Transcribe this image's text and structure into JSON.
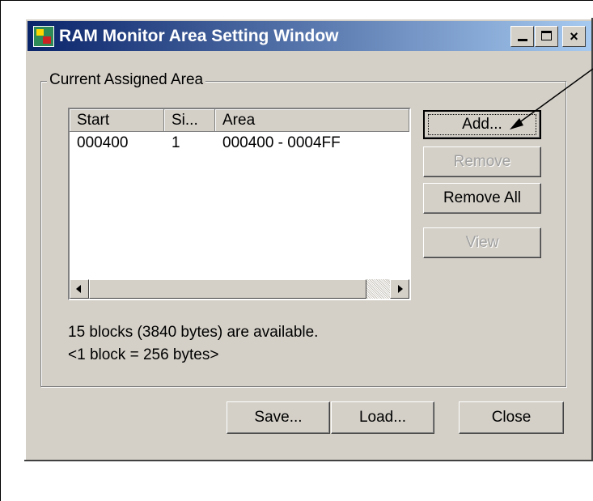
{
  "window": {
    "title": "RAM Monitor Area Setting Window",
    "titlebar_buttons": {
      "minimize": "minimize",
      "maximize": "maximize",
      "close": "×"
    }
  },
  "group": {
    "label": "Current Assigned Area"
  },
  "list": {
    "columns": [
      "Start",
      "Si...",
      "Area"
    ],
    "rows": [
      {
        "start": "000400",
        "size": "1",
        "area": "000400 - 0004FF"
      }
    ]
  },
  "side_buttons": {
    "add": "Add...",
    "remove": "Remove",
    "remove_all": "Remove All",
    "view": "View"
  },
  "info": {
    "available": "15 blocks (3840 bytes) are available.",
    "block_size": "<1 block = 256 bytes>"
  },
  "bottom_buttons": {
    "save": "Save...",
    "load": "Load...",
    "close": "Close"
  },
  "colors": {
    "titlebar_start": "#0a246a",
    "titlebar_end": "#a6caf0",
    "face": "#d4d0c8",
    "disabled_text": "#a0a0a0"
  }
}
